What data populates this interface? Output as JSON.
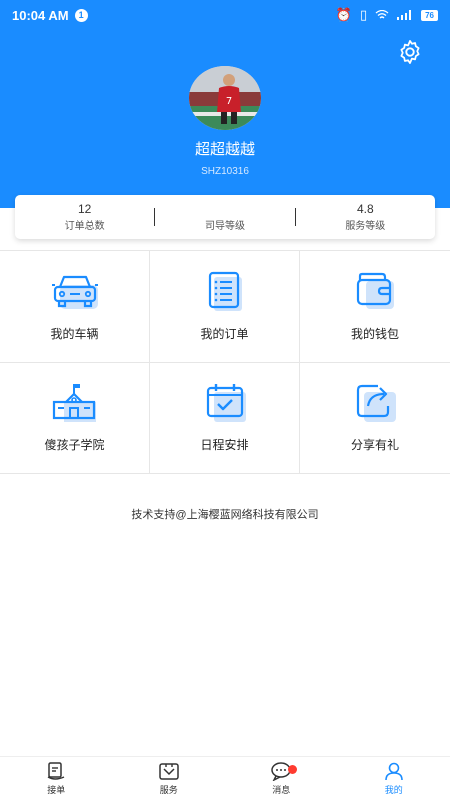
{
  "status": {
    "time": "10:04 AM",
    "notification": "1",
    "battery": "76"
  },
  "profile": {
    "name": "超超越越",
    "id": "SHZ10316"
  },
  "stats": [
    {
      "value": "12",
      "label": "订单总数"
    },
    {
      "value": "",
      "label": "司导等级"
    },
    {
      "value": "4.8",
      "label": "服务等级"
    }
  ],
  "grid": [
    {
      "label": "我的车辆",
      "icon": "car-icon"
    },
    {
      "label": "我的订单",
      "icon": "order-list-icon"
    },
    {
      "label": "我的钱包",
      "icon": "wallet-icon"
    },
    {
      "label": "傻孩子学院",
      "icon": "school-icon"
    },
    {
      "label": "日程安排",
      "icon": "calendar-icon"
    },
    {
      "label": "分享有礼",
      "icon": "share-icon"
    }
  ],
  "footer": {
    "support": "技术支持@上海樱蓝网络科技有限公司"
  },
  "tabs": [
    {
      "label": "接单",
      "icon": "accept-order-icon"
    },
    {
      "label": "服务",
      "icon": "service-icon"
    },
    {
      "label": "消息",
      "icon": "message-icon"
    },
    {
      "label": "我的",
      "icon": "profile-icon"
    }
  ],
  "colors": {
    "primary": "#1a8cff",
    "badge": "#ff3b30",
    "icon_shadow": "#cfe3fb"
  }
}
